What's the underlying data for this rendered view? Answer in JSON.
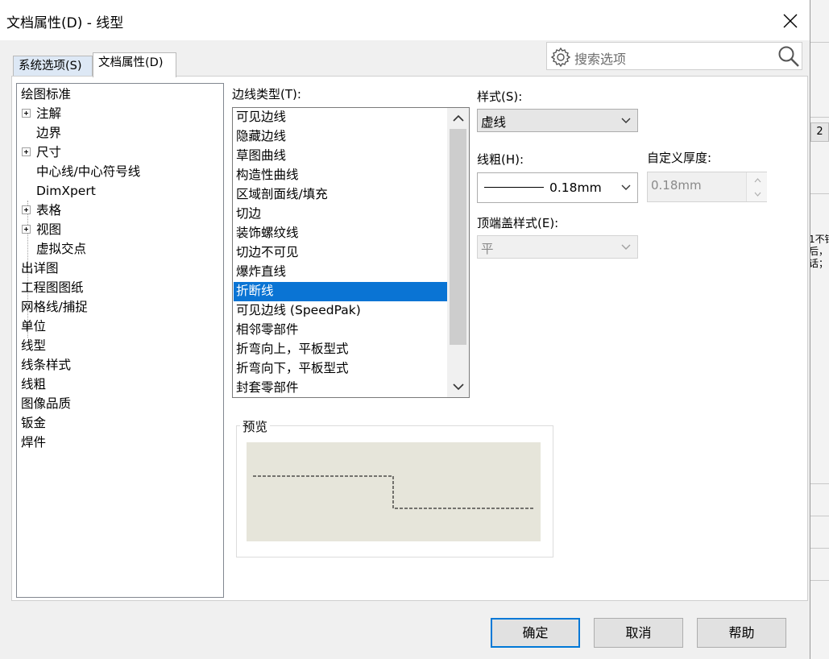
{
  "window": {
    "title": "文档属性(D) - 线型"
  },
  "tabs": [
    {
      "label": "系统选项(S)"
    },
    {
      "label": "文档属性(D)"
    }
  ],
  "search": {
    "placeholder": "搜索选项"
  },
  "tree": {
    "items": [
      {
        "label": "绘图标准",
        "expandable": false
      },
      {
        "label": "注解",
        "expandable": true
      },
      {
        "label": "边界",
        "expandable": false
      },
      {
        "label": "尺寸",
        "expandable": true
      },
      {
        "label": "中心线/中心符号线",
        "expandable": false
      },
      {
        "label": "DimXpert",
        "expandable": false
      },
      {
        "label": "表格",
        "expandable": true
      },
      {
        "label": "视图",
        "expandable": true
      },
      {
        "label": "虚拟交点",
        "expandable": false
      },
      {
        "label": "出详图",
        "expandable": false
      },
      {
        "label": "工程图图纸",
        "expandable": false
      },
      {
        "label": "网格线/捕捉",
        "expandable": false
      },
      {
        "label": "单位",
        "expandable": false
      },
      {
        "label": "线型",
        "expandable": false
      },
      {
        "label": "线条样式",
        "expandable": false
      },
      {
        "label": "线粗",
        "expandable": false
      },
      {
        "label": "图像品质",
        "expandable": false
      },
      {
        "label": "钣金",
        "expandable": false
      },
      {
        "label": "焊件",
        "expandable": false
      }
    ]
  },
  "edge_type": {
    "label": "边线类型(T):",
    "selected_index": 9,
    "items": [
      "可见边线",
      "隐藏边线",
      "草图曲线",
      "构造性曲线",
      "区域剖面线/填充",
      "切边",
      "装饰螺纹线",
      "切边不可见",
      "爆炸直线",
      "折断线",
      "可见边线 (SpeedPak)",
      "相邻零部件",
      "折弯向上，平板型式",
      "折弯向下，平板型式",
      "封套零部件"
    ]
  },
  "style": {
    "label": "样式(S):",
    "value": "虚线"
  },
  "weight": {
    "label": "线粗(H):",
    "value": "0.18mm"
  },
  "custom_thickness": {
    "label": "自定义厚度:",
    "value": "0.18mm"
  },
  "end_cap": {
    "label": "顶端盖样式(E):",
    "value": "平"
  },
  "preview": {
    "label": "预览"
  },
  "buttons": {
    "ok": "确定",
    "cancel": "取消",
    "help": "帮助"
  },
  "background_app": {
    "tab_number": "2",
    "text_lines": [
      "1不销",
      "后，",
      "话；"
    ]
  },
  "colors": {
    "selection": "#0a74d4",
    "preview_bg": "#e6e5da",
    "default_button_border": "#0078d7"
  }
}
